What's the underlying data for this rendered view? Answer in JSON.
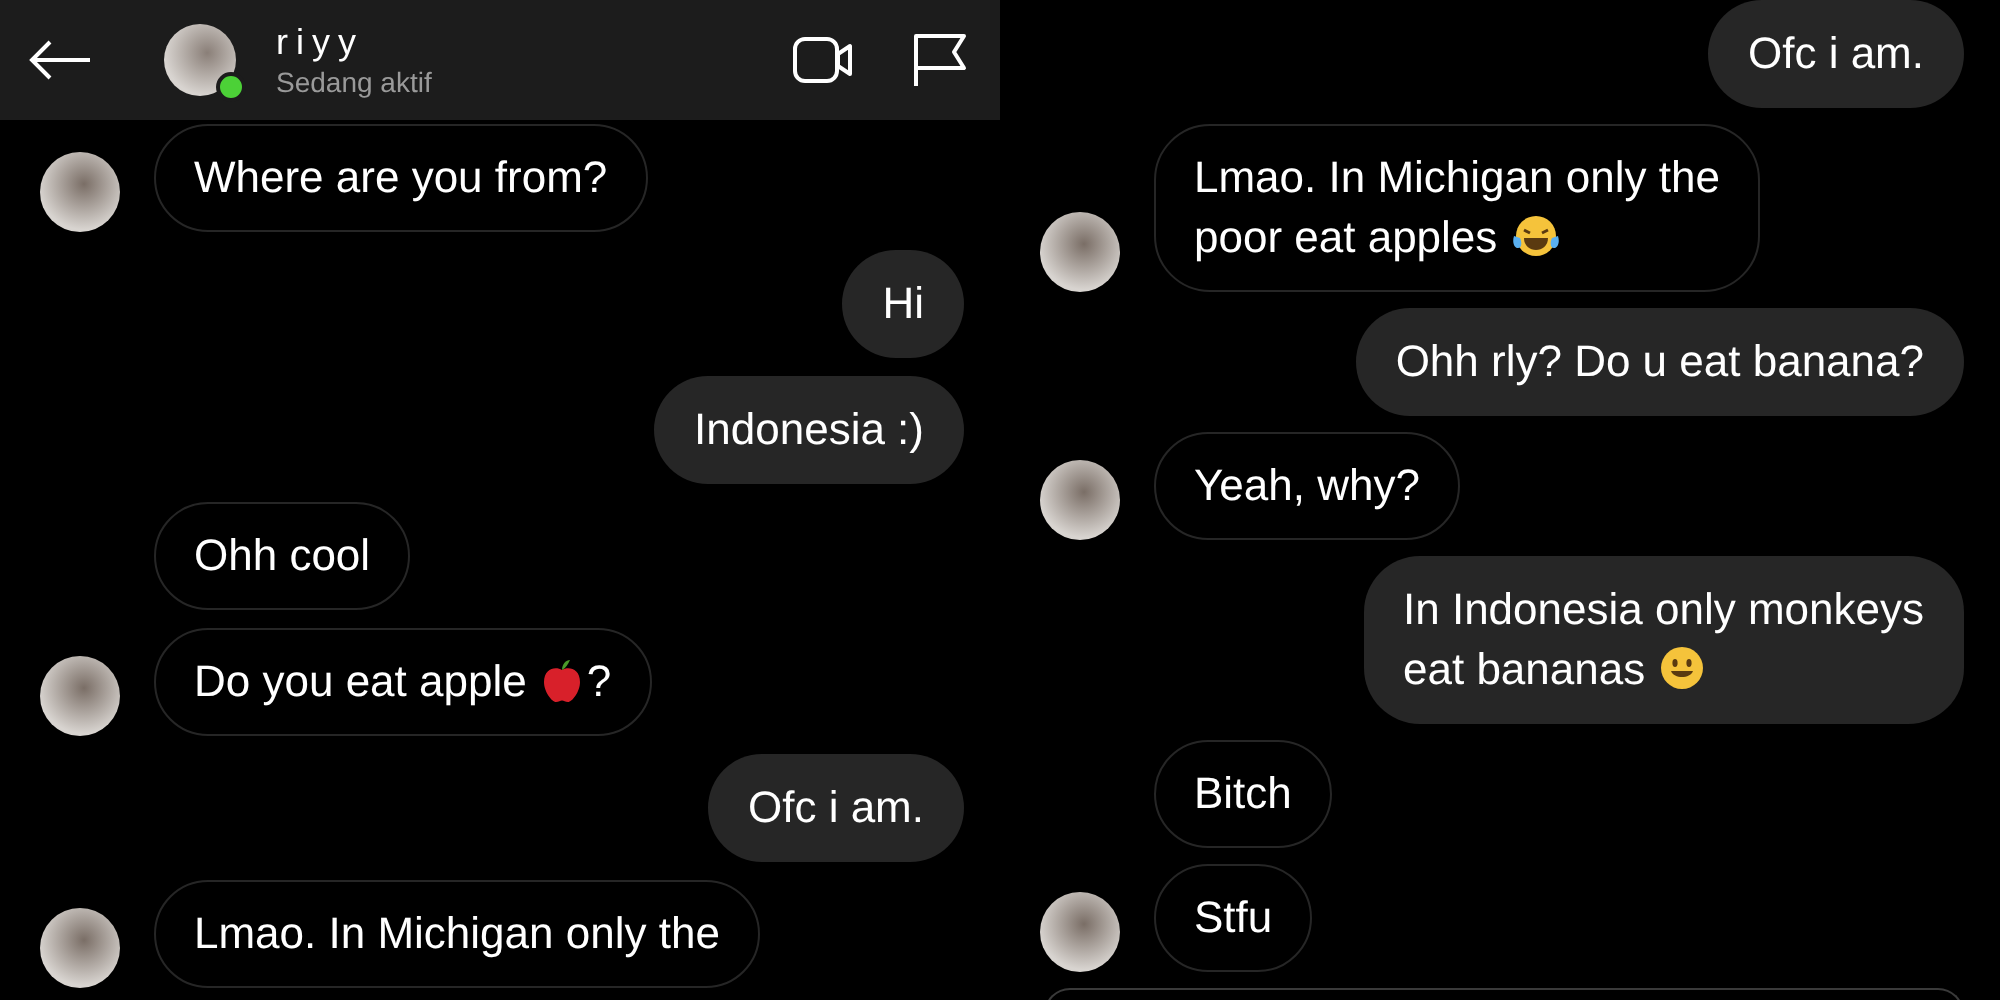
{
  "screens": [
    {
      "header": {
        "name": "riyy",
        "status": "Sedang aktif",
        "online": true
      },
      "messages": [
        {
          "kind": "received",
          "avatar": true,
          "lines": [
            [
              {
                "kind": "text",
                "text": "Where are you from?"
              }
            ]
          ]
        },
        {
          "kind": "sent",
          "lines": [
            [
              {
                "kind": "text",
                "text": "Hi"
              }
            ]
          ]
        },
        {
          "kind": "sent",
          "lines": [
            [
              {
                "kind": "text",
                "text": "Indonesia :)"
              }
            ]
          ]
        },
        {
          "kind": "received",
          "avatar": false,
          "lines": [
            [
              {
                "kind": "text",
                "text": "Ohh cool"
              }
            ]
          ]
        },
        {
          "kind": "received",
          "avatar": true,
          "lines": [
            [
              {
                "kind": "text",
                "text": "Do you eat apple"
              },
              {
                "kind": "apple"
              },
              {
                "kind": "text",
                "text": "?"
              }
            ]
          ]
        },
        {
          "kind": "sent",
          "lines": [
            [
              {
                "kind": "text",
                "text": "Ofc i am."
              }
            ]
          ]
        },
        {
          "kind": "received",
          "avatar": true,
          "lines": [
            [
              {
                "kind": "text",
                "text": "Lmao. In Michigan only the"
              }
            ]
          ]
        }
      ]
    },
    {
      "messages": [
        {
          "kind": "sent",
          "lines": [
            [
              {
                "kind": "text",
                "text": "Ofc i am."
              }
            ]
          ]
        },
        {
          "kind": "received",
          "avatar": true,
          "lines": [
            [
              {
                "kind": "text",
                "text": "Lmao. In Michigan only the"
              }
            ],
            [
              {
                "kind": "text",
                "text": "poor eat apples"
              },
              {
                "kind": "laugh"
              }
            ]
          ]
        },
        {
          "kind": "sent",
          "lines": [
            [
              {
                "kind": "text",
                "text": "Ohh rly? Do u eat banana?"
              }
            ]
          ]
        },
        {
          "kind": "received",
          "avatar": true,
          "lines": [
            [
              {
                "kind": "text",
                "text": "Yeah, why?"
              }
            ]
          ]
        },
        {
          "kind": "sent",
          "lines": [
            [
              {
                "kind": "text",
                "text": "In Indonesia only monkeys"
              }
            ],
            [
              {
                "kind": "text",
                "text": "eat bananas"
              },
              {
                "kind": "smile"
              }
            ]
          ]
        },
        {
          "kind": "received",
          "avatar": false,
          "lines": [
            [
              {
                "kind": "text",
                "text": "Bitch"
              }
            ]
          ]
        },
        {
          "kind": "received",
          "avatar": true,
          "lines": [
            [
              {
                "kind": "text",
                "text": "Stfu"
              }
            ]
          ]
        }
      ],
      "composer": true
    }
  ]
}
